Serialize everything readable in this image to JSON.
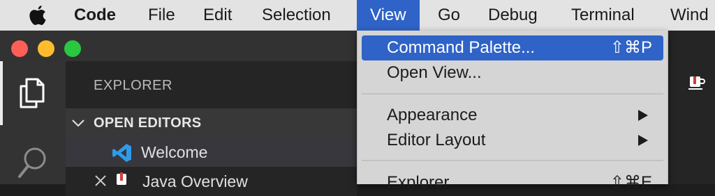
{
  "menubar": {
    "app_name": "Code",
    "items": [
      "File",
      "Edit",
      "Selection",
      "View",
      "Go",
      "Debug",
      "Terminal",
      "Wind"
    ]
  },
  "sidebar": {
    "title": "EXPLORER",
    "section_title": "OPEN EDITORS",
    "editors": [
      {
        "name": "Welcome",
        "icon": "vscode-icon"
      },
      {
        "name": "Java Overview",
        "icon": "java-icon"
      }
    ]
  },
  "view_menu": {
    "items": [
      {
        "label": "Command Palette...",
        "shortcut": "⇧⌘P",
        "highlighted": true
      },
      {
        "label": "Open View...",
        "shortcut": ""
      },
      {
        "label": "Appearance",
        "submenu": true
      },
      {
        "label": "Editor Layout",
        "submenu": true
      },
      {
        "label": "Explorer",
        "shortcut": "⇧⌘E"
      }
    ]
  },
  "colors": {
    "menu_highlight": "#2f63c7",
    "menubar_bg": "#e3e3e3",
    "sidebar_bg": "#252526",
    "activitybar_bg": "#333333",
    "close": "#ff5f57",
    "minimize": "#ffbd2e",
    "zoom": "#28c840"
  }
}
